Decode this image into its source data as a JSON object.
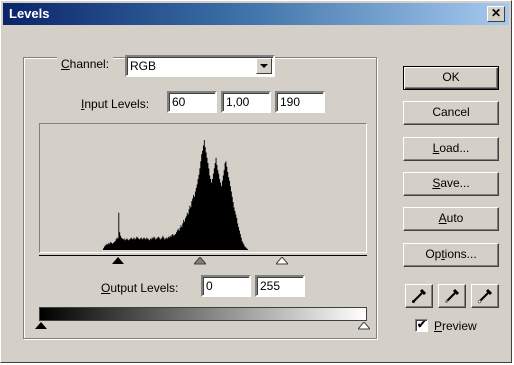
{
  "window": {
    "title": "Levels",
    "close_glyph": "✕"
  },
  "channel": {
    "label_prefix": "",
    "label_hotkey": "C",
    "label_rest": "hannel:",
    "value": "RGB"
  },
  "input_levels": {
    "label_hotkey": "I",
    "label_rest": "nput Levels:",
    "black": "60",
    "gamma": "1,00",
    "white": "190"
  },
  "output_levels": {
    "label_hotkey": "O",
    "label_rest": "utput Levels:",
    "black": "0",
    "white": "255"
  },
  "buttons": {
    "ok": "OK",
    "cancel": "Cancel",
    "load": {
      "hotkey": "L",
      "rest": "oad..."
    },
    "save": {
      "hotkey": "S",
      "rest": "ave..."
    },
    "auto": {
      "hotkey": "A",
      "rest": "uto"
    },
    "options": {
      "pre": "Op",
      "hotkey": "t",
      "rest": "ions..."
    }
  },
  "preview": {
    "checked_glyph": "✔",
    "label_hotkey": "P",
    "label_rest": "review",
    "checked": true
  },
  "histogram": {
    "heights": [
      0,
      0,
      0,
      0,
      0,
      0,
      0,
      0,
      0,
      0,
      0,
      0,
      0,
      0,
      0,
      0,
      0,
      0,
      0,
      0,
      0,
      0,
      0,
      0,
      0,
      0,
      0,
      0,
      0,
      0,
      0,
      0,
      0,
      0,
      0,
      0,
      0,
      0,
      0,
      0,
      0,
      0,
      0,
      0,
      0,
      0,
      0,
      0,
      0,
      0,
      0,
      0,
      0,
      0,
      0,
      0,
      0,
      0,
      0,
      0,
      0,
      0,
      0,
      0,
      0,
      0,
      0,
      0,
      0,
      0,
      2,
      4,
      5,
      6,
      7,
      6,
      8,
      7,
      9,
      8,
      7,
      8,
      9,
      10,
      12,
      14,
      13,
      42,
      20,
      16,
      14,
      13,
      12,
      13,
      11,
      12,
      13,
      12,
      11,
      12,
      13,
      14,
      12,
      13,
      14,
      12,
      13,
      15,
      14,
      13,
      12,
      13,
      14,
      12,
      13,
      14,
      13,
      12,
      14,
      13,
      12,
      11,
      13,
      12,
      14,
      13,
      15,
      14,
      12,
      13,
      14,
      15,
      14,
      12,
      13,
      14,
      16,
      14,
      12,
      13,
      14,
      13,
      15,
      14,
      16,
      15,
      17,
      18,
      16,
      17,
      18,
      20,
      22,
      24,
      22,
      25,
      28,
      26,
      30,
      34,
      32,
      36,
      38,
      42,
      40,
      46,
      50,
      48,
      55,
      58,
      62,
      60,
      66,
      70,
      74,
      80,
      85,
      92,
      100,
      108,
      112,
      118,
      124,
      116,
      110,
      104,
      98,
      92,
      84,
      80,
      76,
      80,
      86,
      92,
      98,
      104,
      96,
      90,
      86,
      80,
      76,
      72,
      78,
      84,
      90,
      98,
      100,
      94,
      88,
      82,
      78,
      72,
      66,
      60,
      54,
      48,
      44,
      40,
      36,
      30,
      26,
      22,
      18,
      14,
      10,
      8,
      6,
      4,
      3,
      2,
      1,
      0,
      0,
      0,
      0,
      0,
      0,
      0,
      0,
      0,
      0,
      0,
      0,
      0,
      0,
      0,
      0,
      0,
      0,
      0,
      0,
      0,
      0,
      0,
      0,
      0,
      0,
      0,
      0,
      0,
      0,
      0,
      0,
      0,
      0,
      0,
      0,
      0,
      0,
      0,
      0,
      0,
      0,
      0,
      0,
      0,
      0,
      0,
      0,
      0,
      0,
      0,
      0,
      0,
      0,
      0,
      0,
      0,
      0,
      0,
      0,
      0,
      0,
      0,
      0,
      0,
      0,
      0,
      0,
      0,
      0,
      0,
      0,
      0,
      0,
      0,
      0,
      0,
      0,
      0,
      0,
      0,
      0,
      0,
      0,
      0,
      0,
      0,
      0,
      0,
      0,
      0,
      0,
      0,
      0,
      0,
      0,
      0,
      0,
      0,
      0,
      0,
      0,
      0,
      0,
      0,
      0,
      0,
      0,
      0,
      0,
      0,
      0,
      0,
      0,
      0,
      0,
      0,
      0,
      0,
      0,
      0,
      0,
      0,
      0,
      0,
      0,
      0,
      0,
      0,
      0,
      0
    ]
  },
  "colors": {
    "face": "#d4d0c8",
    "title_start": "#0a246a",
    "title_end": "#a6caf0"
  }
}
